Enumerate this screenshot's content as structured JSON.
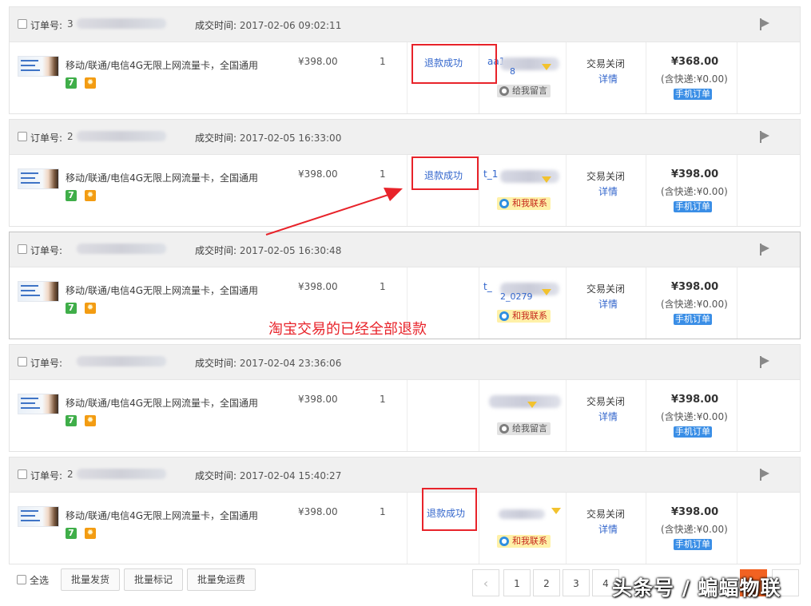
{
  "labels": {
    "order_no": "订单号:",
    "deal_time": "成交时间:",
    "refund": "退款成功",
    "status": "交易关闭",
    "detail": "详情",
    "shipping": "(含快递:¥0.00)",
    "mobile_order": "手机订单",
    "leave_message": "给我留言",
    "contact_me": "和我联系",
    "product_title": "移动/联通/电信4G无限上网流量卡，全国通用",
    "unit_price": "¥398.00",
    "seven_badge": "7"
  },
  "orders": [
    {
      "order_no_prefix": "3",
      "deal_time": "2017-02-06 09:02:11",
      "qty": "1",
      "buyer_name": "aa1",
      "buyer_sub": "8",
      "contact_type": "leave_message",
      "total": "¥368.00"
    },
    {
      "order_no_prefix": "2",
      "deal_time": "2017-02-05 16:33:00",
      "qty": "1",
      "buyer_name": "t_1",
      "buyer_sub": "",
      "contact_type": "contact_me",
      "total": "¥398.00"
    },
    {
      "order_no_prefix": "",
      "deal_time": "2017-02-05 16:30:48",
      "qty": "1",
      "buyer_name": "t_",
      "buyer_sub": "2_0279",
      "contact_type": "contact_me",
      "total": "¥398.00"
    },
    {
      "order_no_prefix": "",
      "deal_time": "2017-02-04 23:36:06",
      "qty": "1",
      "buyer_name": "",
      "buyer_sub": "",
      "contact_type": "leave_message",
      "total": "¥398.00"
    },
    {
      "order_no_prefix": "2",
      "deal_time": "2017-02-04 15:40:27",
      "qty": "1",
      "buyer_name": "",
      "buyer_sub": "",
      "contact_type": "contact_me",
      "total": "¥398.00"
    }
  ],
  "annotation": "淘宝交易的已经全部退款",
  "bottom": {
    "select_all": "全选",
    "batch_ship": "批量发货",
    "batch_mark": "批量标记",
    "batch_free_shipping": "批量免运费",
    "prev": "‹",
    "pages": [
      "1",
      "2",
      "3",
      "4"
    ]
  },
  "watermark": "头条号 / 蝙蝠物联",
  "colors": {
    "link": "#3366cc",
    "highlight": "#e8232a",
    "accent_orange": "#f26222",
    "mobile_badge": "#3a8ee6"
  }
}
